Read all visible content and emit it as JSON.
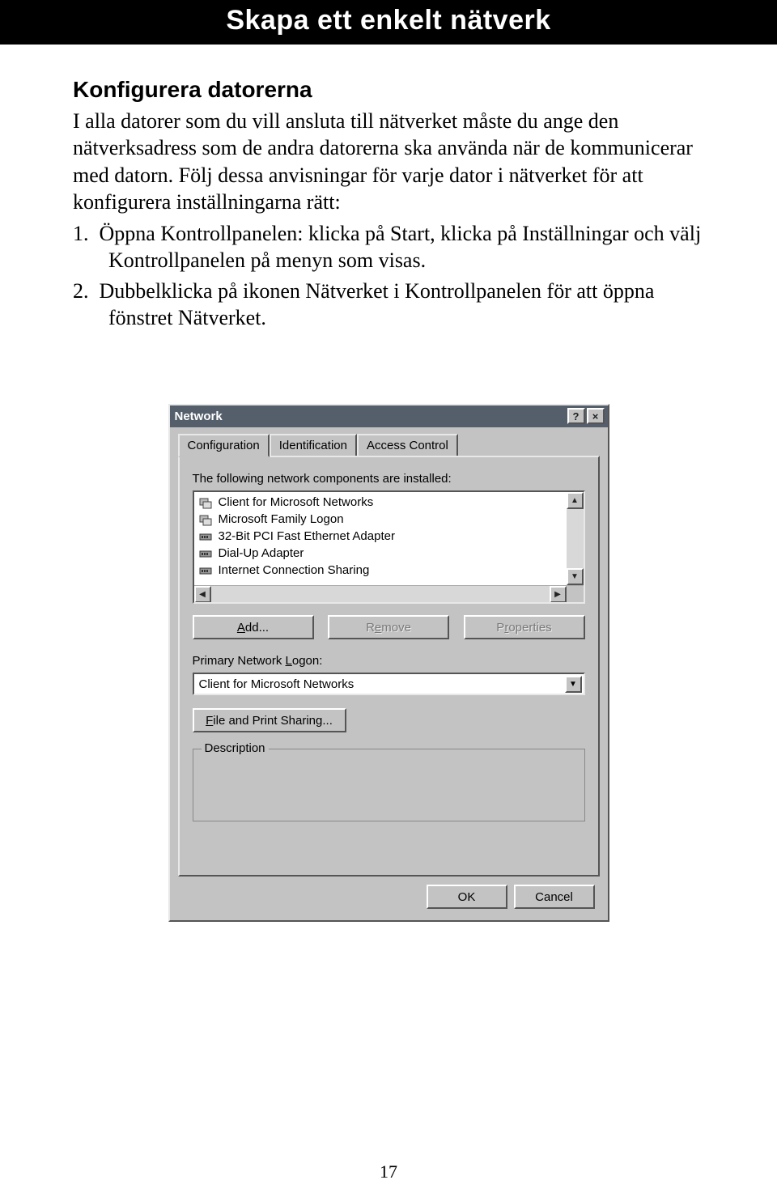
{
  "banner": {
    "title": "Skapa ett enkelt nätverk"
  },
  "section": {
    "heading": "Konfigurera datorerna",
    "para": "I alla datorer som du vill ansluta till nätverket måste du ange den nätverksadress som de andra datorerna ska använda när de kommunicerar med datorn. Följ dessa anvisningar för varje dator i nätverket för att konfigurera inställningarna rätt:",
    "steps": [
      "Öppna Kontrollpanelen: klicka på Start, klicka på Inställningar och välj Kontrollpanelen på menyn som visas.",
      "Dubbelklicka på ikonen Nätverket i Kontrollpanelen för att öppna fönstret Nätverket."
    ]
  },
  "dialog": {
    "title": "Network",
    "help_symbol": "?",
    "close_symbol": "×",
    "tabs": [
      "Configuration",
      "Identification",
      "Access Control"
    ],
    "components_label": "The following network components are installed:",
    "components": [
      "Client for Microsoft Networks",
      "Microsoft Family Logon",
      "32-Bit PCI Fast Ethernet Adapter",
      "Dial-Up Adapter",
      "Internet Connection Sharing"
    ],
    "buttons": {
      "add": "Add...",
      "remove": "Remove",
      "properties": "Properties"
    },
    "logon_label": "Primary Network Logon:",
    "logon_value": "Client for Microsoft Networks",
    "file_share": "File and Print Sharing...",
    "description_label": "Description",
    "ok": "OK",
    "cancel": "Cancel"
  },
  "page_number": "17"
}
